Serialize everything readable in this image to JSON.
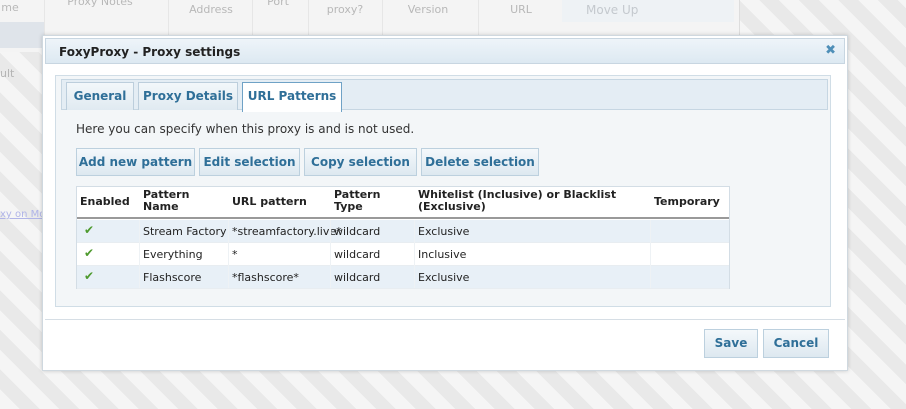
{
  "background": {
    "columns": [
      {
        "label": "me"
      },
      {
        "label": "Proxy Notes"
      },
      {
        "label": "Address"
      },
      {
        "label": "Port"
      },
      {
        "label": "proxy?"
      },
      {
        "label": "Version"
      },
      {
        "label": "URL"
      }
    ],
    "move_up_label": "Move Up",
    "side_text": "ult",
    "side_link": "xy on Mo"
  },
  "dialog": {
    "title": "FoxyProxy - Proxy settings",
    "close_label": "✖",
    "tabs": [
      {
        "label": "General",
        "active": false
      },
      {
        "label": "Proxy Details",
        "active": false
      },
      {
        "label": "URL Patterns",
        "active": true
      }
    ],
    "description": "Here you can specify when this proxy is and is not used.",
    "actions": {
      "add": "Add new pattern",
      "edit": "Edit selection",
      "copy": "Copy selection",
      "delete": "Delete selection"
    },
    "table": {
      "headers": {
        "enabled": "Enabled",
        "pattern_name_1": "Pattern",
        "pattern_name_2": "Name",
        "url_pattern": "URL pattern",
        "pattern_type_1": "Pattern",
        "pattern_type_2": "Type",
        "list_1": "Whitelist (Inclusive) or Blacklist",
        "list_2": "(Exclusive)",
        "temporary": "Temporary"
      },
      "rows": [
        {
          "enabled": "✔",
          "name": "Stream Factory",
          "url": "*streamfactory.live*",
          "type": "wildcard",
          "list": "Exclusive",
          "temporary": ""
        },
        {
          "enabled": "✔",
          "name": "Everything",
          "url": "*",
          "type": "wildcard",
          "list": "Inclusive",
          "temporary": ""
        },
        {
          "enabled": "✔",
          "name": "Flashscore",
          "url": "*flashscore*",
          "type": "wildcard",
          "list": "Exclusive",
          "temporary": ""
        }
      ]
    },
    "footer": {
      "save": "Save",
      "cancel": "Cancel"
    }
  }
}
